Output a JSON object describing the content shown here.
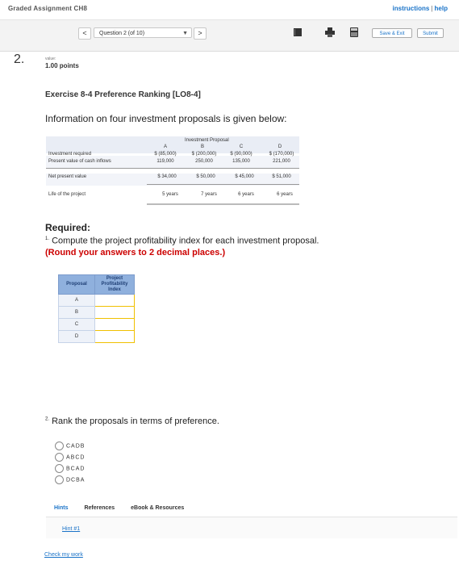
{
  "app": {
    "title": "Graded Assignment CH8",
    "links": [
      "instructions",
      "help"
    ]
  },
  "nav": {
    "prev_label": "<",
    "next_label": ">",
    "question_select": "Question 2 (of 10)",
    "save_exit_label": "Save & Exit",
    "submit_label": "Submit",
    "toolbar_icons": [
      "book-icon",
      "print-icon",
      "calculator-icon"
    ]
  },
  "question": {
    "number": "2.",
    "value_label": "value:",
    "points": "1.00 points",
    "title": "Exercise 8-4 Preference Ranking [LO8-4]",
    "intro": "Information on four investment proposals is given below:"
  },
  "investment_table": {
    "group_header": "Investment Proposal",
    "columns": [
      "A",
      "B",
      "C",
      "D"
    ],
    "rows": [
      {
        "label": "Investment required",
        "values": [
          "$ (85,000)",
          "$ (200,000)",
          "$ (90,000)",
          "$ (170,000)"
        ]
      },
      {
        "label": "Present value of cash inflows",
        "values": [
          "119,000",
          "250,000",
          "135,000",
          "221,000"
        ]
      },
      {
        "label": "Net present value",
        "values": [
          "$   34,000",
          "$   50,000",
          "$   45,000",
          "$   51,000"
        ]
      },
      {
        "label": "Life of the project",
        "values": [
          "5 years",
          "7 years",
          "6 years",
          "6 years"
        ]
      }
    ]
  },
  "required": {
    "heading": "Required:",
    "q1_num": "1.",
    "q1_text": "Compute the project profitability index for each investment proposal.",
    "q1_note": "(Round your answers to 2 decimal places.)",
    "pi_headers": [
      "Proposal",
      "Project Profitability Index"
    ],
    "pi_rows": [
      "A",
      "B",
      "C",
      "D"
    ],
    "q2_num": "2.",
    "q2_text": "Rank the proposals in terms of preference.",
    "options": [
      "CADB",
      "ABCD",
      "BCAD",
      "DCBA"
    ]
  },
  "tabs": {
    "items": [
      "Hints",
      "References",
      "eBook & Resources"
    ],
    "hint_link": "Hint #1"
  },
  "footer": {
    "check_link": "Check my work"
  }
}
